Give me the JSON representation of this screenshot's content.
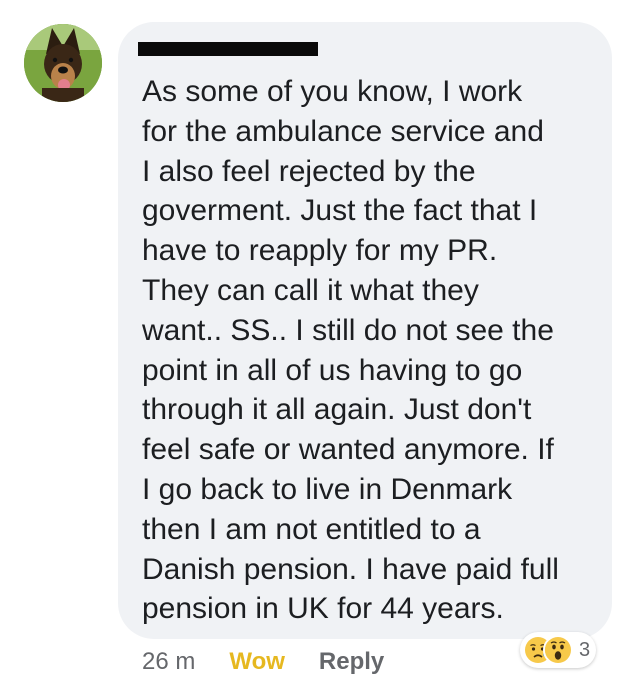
{
  "comment": {
    "author_avatar_icon": "german-shepherd-avatar-icon",
    "author_name_redacted": true,
    "text_lines": [
      "As some of you know, I work",
      "for the ambulance service and",
      "I also feel rejected by the",
      "goverment. Just the fact that I",
      "have to reapply for my PR.",
      "They can call it what they",
      "want.. SS.. I still do not see the",
      "point in all of us having to go",
      "through it all again. Just don't",
      "feel safe or wanted anymore. If",
      "I go back to live in Denmark",
      "then I am not entitled to a",
      "Danish pension. I have paid full",
      "pension in UK for 44 years."
    ]
  },
  "footer": {
    "timestamp": "26 m",
    "reaction_label": "Wow",
    "reply_label": "Reply"
  },
  "reactions": {
    "icons": [
      "sad-reaction-icon",
      "wow-reaction-icon"
    ],
    "count": "3"
  },
  "colors": {
    "bubble_background": "#f0f2f5",
    "text": "#1c1e21",
    "secondary_text": "#65676b",
    "wow_accent": "#e6b820"
  }
}
